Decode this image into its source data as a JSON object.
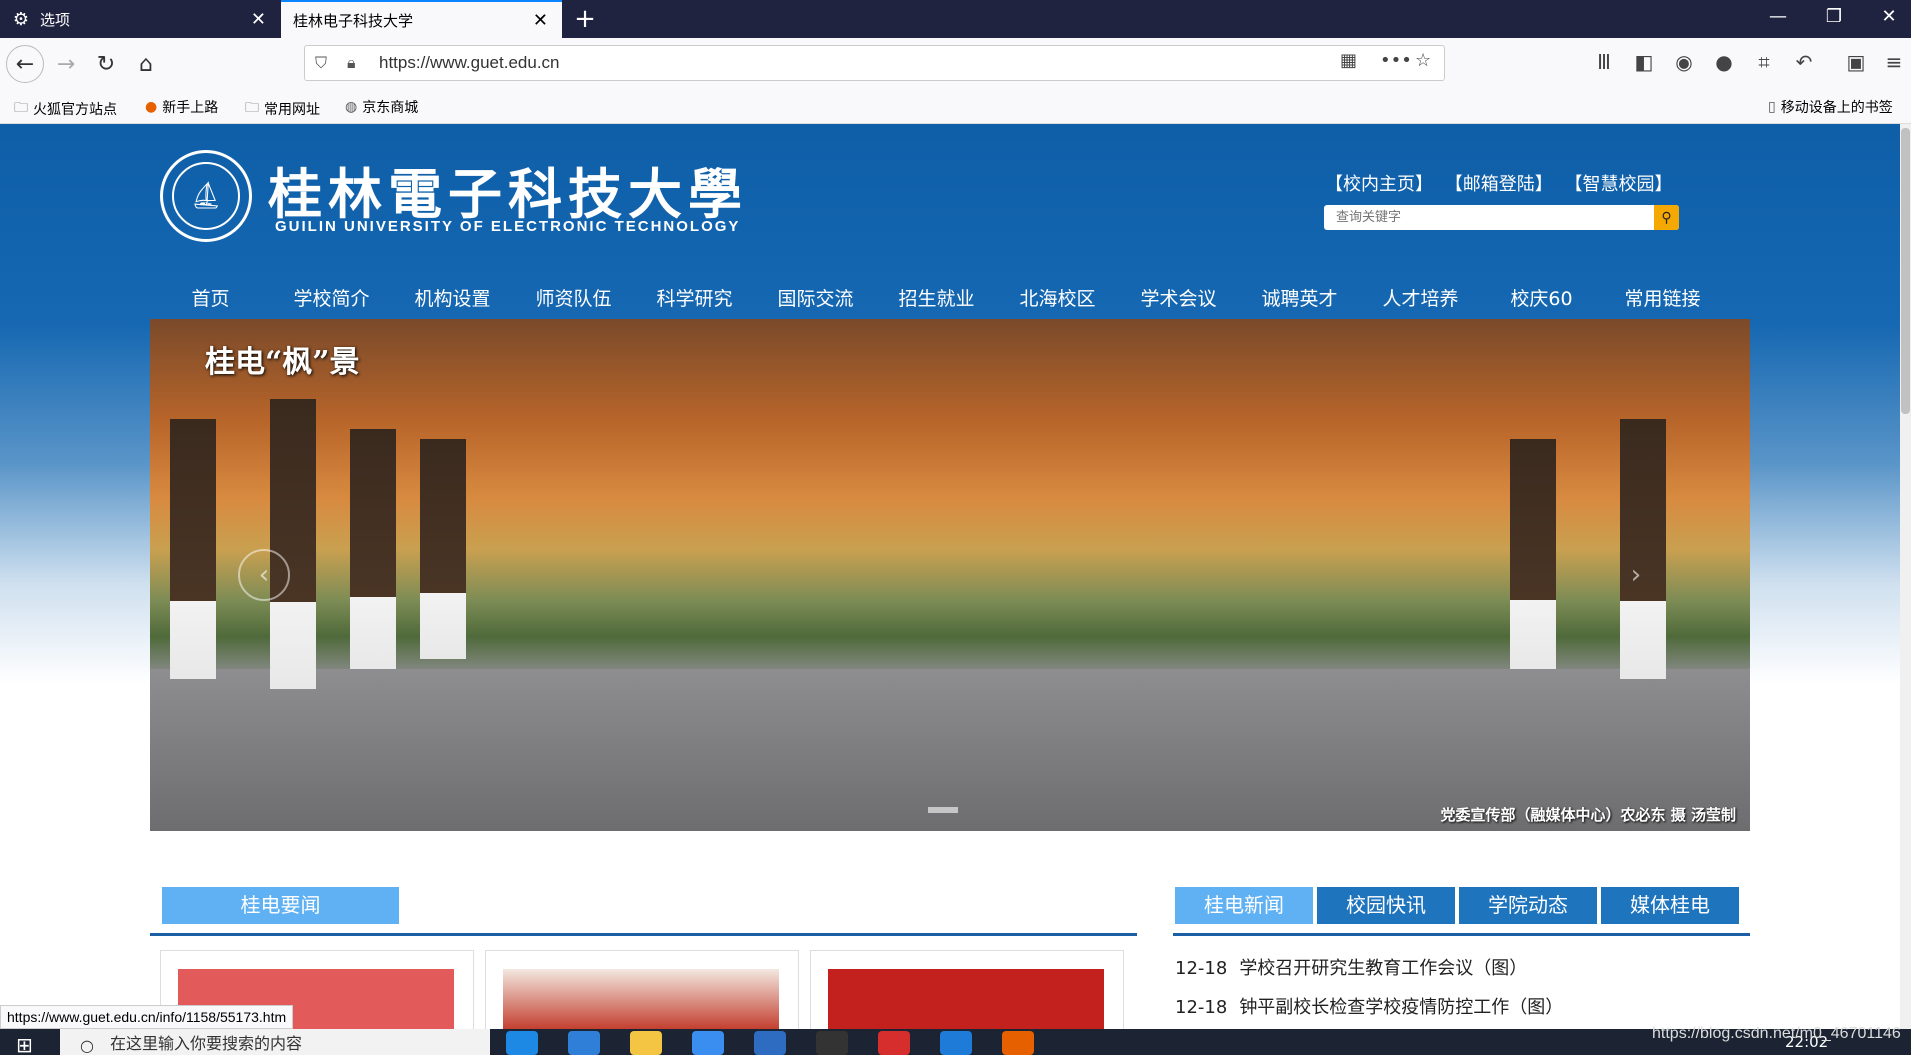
{
  "browser": {
    "tabs": [
      {
        "label": "选项",
        "icon": "gear-icon"
      },
      {
        "label": "桂林电子科技大学",
        "icon": "page-icon"
      }
    ],
    "url": "https://www.guet.edu.cn",
    "bookmarks": [
      {
        "label": "火狐官方站点",
        "icon": "folder-icon"
      },
      {
        "label": "新手上路",
        "icon": "firefox-icon"
      },
      {
        "label": "常用网址",
        "icon": "folder-icon"
      },
      {
        "label": "京东商城",
        "icon": "globe-icon"
      }
    ],
    "mobile_bookmarks": "移动设备上的书签",
    "status_url": "https://www.guet.edu.cn/info/1158/55173.htm"
  },
  "site": {
    "cn_name": "桂林電子科技大學",
    "en_name": "GUILIN UNIVERSITY OF ELECTRONIC TECHNOLOGY",
    "top_links": [
      "【校内主页】",
      "【邮箱登陆】",
      "【智慧校园】"
    ],
    "search_placeholder": "查询关键字",
    "menu": [
      "首页",
      "学校简介",
      "机构设置",
      "师资队伍",
      "科学研究",
      "国际交流",
      "招生就业",
      "北海校区",
      "学术会议",
      "诚聘英才",
      "人才培养",
      "校庆60",
      "常用链接"
    ],
    "hero": {
      "caption": "桂电“枫”景",
      "credit": "党委宣传部（融媒体中心）农必东 摄 汤莹制"
    },
    "left_section_title": "桂电要闻",
    "right_tabs": [
      "桂电新闻",
      "校园快讯",
      "学院动态",
      "媒体桂电"
    ],
    "news": [
      {
        "date": "12-18",
        "title": "学校召开研究生教育工作会议（图）"
      },
      {
        "date": "12-18",
        "title": "钟平副校长检查学校疫情防控工作（图）"
      }
    ]
  },
  "taskbar": {
    "search_placeholder": "在这里输入你要搜索的内容",
    "clock": "22:02",
    "watermark": "https://blog.csdn.net/m0_46701146"
  }
}
